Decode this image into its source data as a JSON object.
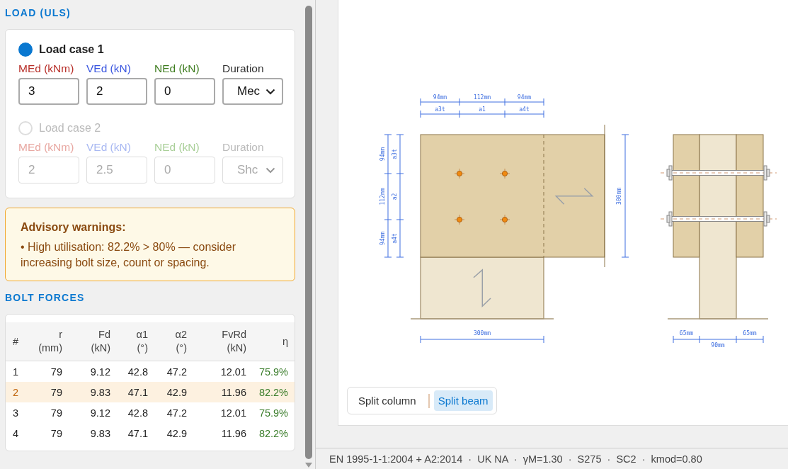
{
  "load_section": {
    "heading": "LOAD (ULS)",
    "load_cases": [
      {
        "label": "Load case 1",
        "selected": true,
        "disabled": false,
        "fields": [
          {
            "label": "MEd (kNm)",
            "kind": "moment",
            "value": "3"
          },
          {
            "label": "VEd (kN)",
            "kind": "shear",
            "value": "2"
          },
          {
            "label": "NEd (kN)",
            "kind": "axial",
            "value": "0"
          }
        ],
        "duration": {
          "label": "Duration",
          "value": "Mec"
        }
      },
      {
        "label": "Load case 2",
        "selected": false,
        "disabled": true,
        "fields": [
          {
            "label": "MEd (kNm)",
            "kind": "moment",
            "value": "2"
          },
          {
            "label": "VEd (kN)",
            "kind": "shear",
            "value": "2.5"
          },
          {
            "label": "NEd (kN)",
            "kind": "axial",
            "value": "0"
          }
        ],
        "duration": {
          "label": "Duration",
          "value": "Shc"
        }
      }
    ]
  },
  "warnings": {
    "title": "Advisory warnings:",
    "items": [
      "• High utilisation: 82.2% > 80% — consider increasing bolt size, count or spacing."
    ]
  },
  "bolt_forces": {
    "heading": "BOLT FORCES",
    "columns": [
      {
        "label": "#"
      },
      {
        "label": "r",
        "unit": "(mm)"
      },
      {
        "label": "Fd",
        "unit": "(kN)"
      },
      {
        "label": "α1",
        "unit": "(°)"
      },
      {
        "label": "α2",
        "unit": "(°)"
      },
      {
        "label": "FvRd",
        "unit": "(kN)"
      },
      {
        "label": "η"
      }
    ],
    "rows": [
      {
        "selected": false,
        "cells": [
          "1",
          "79",
          "9.12",
          "42.8",
          "47.2",
          "12.01",
          "75.9%"
        ]
      },
      {
        "selected": true,
        "cells": [
          "2",
          "79",
          "9.83",
          "47.1",
          "42.9",
          "11.96",
          "82.2%"
        ]
      },
      {
        "selected": false,
        "cells": [
          "3",
          "79",
          "9.12",
          "42.8",
          "47.2",
          "12.01",
          "75.9%"
        ]
      },
      {
        "selected": false,
        "cells": [
          "4",
          "79",
          "9.83",
          "47.1",
          "42.9",
          "11.96",
          "82.2%"
        ]
      }
    ]
  },
  "drawing": {
    "top_mm": [
      "94mm",
      "112mm",
      "94mm"
    ],
    "top_names": [
      "a3t",
      "a1",
      "a4t"
    ],
    "left_mm": [
      "94mm",
      "112mm",
      "94mm"
    ],
    "left_names": [
      "a3t",
      "a2",
      "a4t"
    ],
    "right_height": "300mm",
    "bottom_width": "300mm",
    "side_dims": [
      "65mm",
      "90mm",
      "65mm"
    ]
  },
  "view_toggle": [
    {
      "label": "Split column",
      "selected": false
    },
    {
      "label": "Split beam",
      "selected": true
    }
  ],
  "status_bar": "EN 1995-1-1:2004 + A2:2014  ·  UK NA  ·  γM=1.30  ·  S275  ·  SC2  ·  kmod=0.80"
}
